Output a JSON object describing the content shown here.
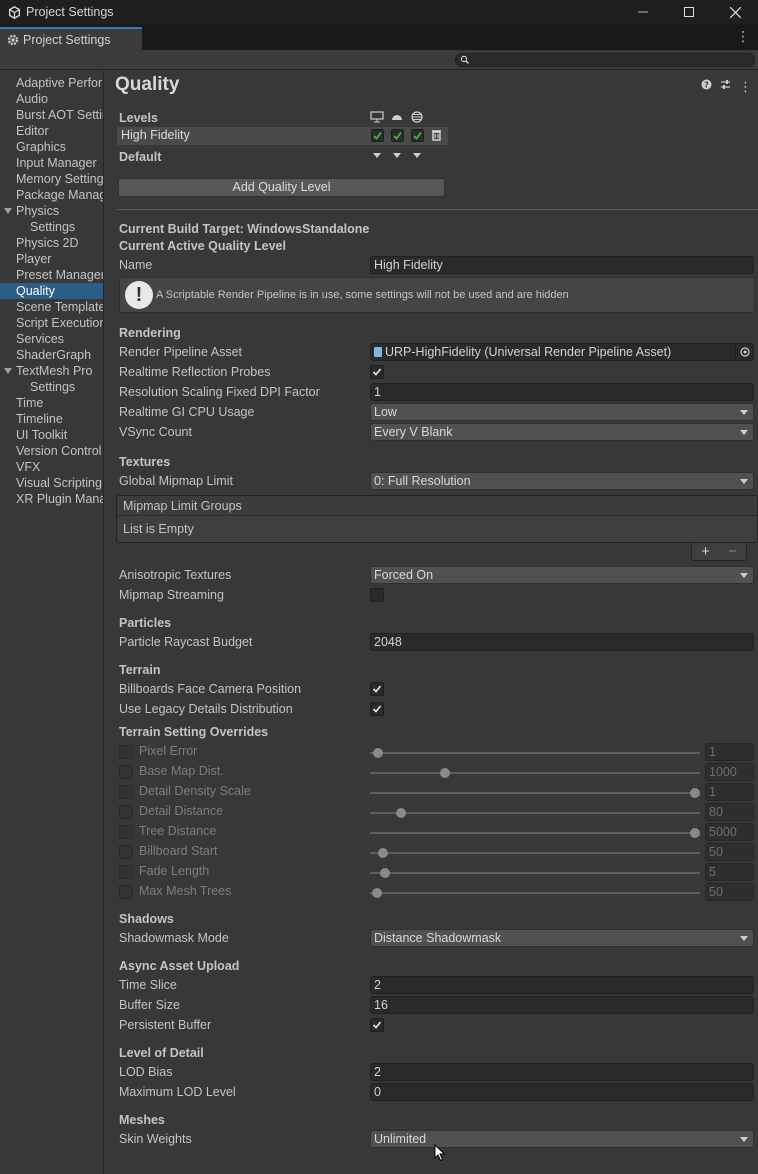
{
  "window": {
    "title": "Project Settings",
    "tab_label": "Project Settings"
  },
  "search": {
    "placeholder": ""
  },
  "sidebar": {
    "items": [
      {
        "label": "Adaptive Performance"
      },
      {
        "label": "Audio"
      },
      {
        "label": "Burst AOT Settings"
      },
      {
        "label": "Editor"
      },
      {
        "label": "Graphics"
      },
      {
        "label": "Input Manager"
      },
      {
        "label": "Memory Settings"
      },
      {
        "label": "Package Manager"
      },
      {
        "label": "Physics"
      },
      {
        "label": "Settings"
      },
      {
        "label": "Physics 2D"
      },
      {
        "label": "Player"
      },
      {
        "label": "Preset Manager"
      },
      {
        "label": "Quality"
      },
      {
        "label": "Scene Template"
      },
      {
        "label": "Script Execution Order"
      },
      {
        "label": "Services"
      },
      {
        "label": "ShaderGraph"
      },
      {
        "label": "TextMesh Pro"
      },
      {
        "label": "Settings"
      },
      {
        "label": "Time"
      },
      {
        "label": "Timeline"
      },
      {
        "label": "UI Toolkit"
      },
      {
        "label": "Version Control"
      },
      {
        "label": "VFX"
      },
      {
        "label": "Visual Scripting"
      },
      {
        "label": "XR Plugin Management"
      }
    ]
  },
  "quality": {
    "title": "Quality",
    "levels_label": "Levels",
    "level_name": "High Fidelity",
    "default_label": "Default",
    "add_level_button": "Add Quality Level",
    "build_target": "Current Build Target: WindowsStandalone",
    "active_level_heading": "Current Active Quality Level",
    "name_label": "Name",
    "name_value": "High Fidelity",
    "help_text": "A Scriptable Render Pipeline is in use, some settings will not be used and are hidden"
  },
  "rendering": {
    "heading": "Rendering",
    "pipeline_label": "Render Pipeline Asset",
    "pipeline_value": "URP-HighFidelity (Universal Render Pipeline Asset)",
    "reflection_label": "Realtime Reflection Probes",
    "dpi_label": "Resolution Scaling Fixed DPI Factor",
    "dpi_value": "1",
    "gi_label": "Realtime GI CPU Usage",
    "gi_value": "Low",
    "vsync_label": "VSync Count",
    "vsync_value": "Every V Blank"
  },
  "textures": {
    "heading": "Textures",
    "mipmap_limit_label": "Global Mipmap Limit",
    "mipmap_limit_value": "0: Full Resolution",
    "groups_label": "Mipmap Limit Groups",
    "groups_empty": "List is Empty",
    "plus": "+",
    "minus": "−",
    "aniso_label": "Anisotropic Textures",
    "aniso_value": "Forced On",
    "streaming_label": "Mipmap Streaming"
  },
  "particles": {
    "heading": "Particles",
    "raycast_label": "Particle Raycast Budget",
    "raycast_value": "2048"
  },
  "terrain": {
    "heading": "Terrain",
    "billboards_label": "Billboards Face Camera Position",
    "legacy_label": "Use Legacy Details Distribution",
    "overrides_heading": "Terrain Setting Overrides",
    "overrides": [
      {
        "label": "Pixel Error",
        "value": "1",
        "level": 0.01
      },
      {
        "label": "Base Map Dist.",
        "value": "1000",
        "level": 0.22
      },
      {
        "label": "Detail Density Scale",
        "value": "1",
        "level": 1.0
      },
      {
        "label": "Detail Distance",
        "value": "80",
        "level": 0.08
      },
      {
        "label": "Tree Distance",
        "value": "5000",
        "level": 1.0
      },
      {
        "label": "Billboard Start",
        "value": "50",
        "level": 0.025
      },
      {
        "label": "Fade Length",
        "value": "5",
        "level": 0.03
      },
      {
        "label": "Max Mesh Trees",
        "value": "50",
        "level": 0.005
      }
    ]
  },
  "shadows": {
    "heading": "Shadows",
    "mode_label": "Shadowmask Mode",
    "mode_value": "Distance Shadowmask"
  },
  "async": {
    "heading": "Async Asset Upload",
    "time_slice_label": "Time Slice",
    "time_slice_value": "2",
    "buffer_label": "Buffer Size",
    "buffer_value": "16",
    "persistent_label": "Persistent Buffer"
  },
  "lod": {
    "heading": "Level of Detail",
    "bias_label": "LOD Bias",
    "bias_value": "2",
    "max_label": "Maximum LOD Level",
    "max_value": "0"
  },
  "meshes": {
    "heading": "Meshes",
    "skin_label": "Skin Weights",
    "skin_value": "Unlimited"
  },
  "colors": {
    "selection": "#2c5d87",
    "check_green": "#3fb83f",
    "tab_accent": "#3a79bb"
  }
}
